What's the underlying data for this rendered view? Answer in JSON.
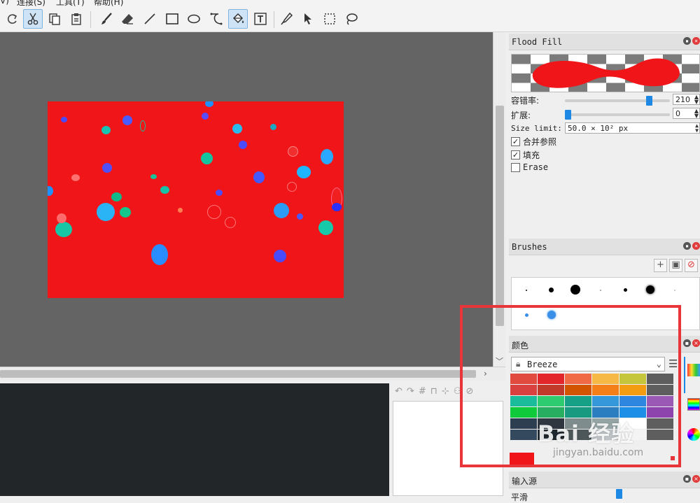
{
  "menu": {
    "item1": "V)",
    "item2": "连接(S)",
    "item3": "工具(T)",
    "item4": "帮助(H)"
  },
  "toolbar": {
    "tools": [
      "redo-icon",
      "cut-icon",
      "copy-icon",
      "paste-icon",
      "brush-icon",
      "eraser-icon",
      "line-icon",
      "rectangle-icon",
      "ellipse-icon",
      "curve-icon",
      "flood-fill-icon",
      "text-icon",
      "color-picker-icon",
      "select-arrow-icon",
      "rect-select-icon",
      "lasso-icon"
    ],
    "active_tools": [
      "cut-icon",
      "flood-fill-icon"
    ]
  },
  "flood_fill": {
    "title": "Flood Fill",
    "tolerance_label": "容错率:",
    "tolerance_value": "210",
    "tolerance_level": 0.82,
    "expand_label": "扩展:",
    "expand_value": "0",
    "expand_level": 0.0,
    "size_limit_label": "Size limit:",
    "size_limit_value": "50.0 × 10² px",
    "merge_label": "合并参照",
    "merge_checked": true,
    "fill_label": "填充",
    "fill_checked": true,
    "erase_label": "Erase",
    "erase_checked": false
  },
  "brushes": {
    "title": "Brushes"
  },
  "colors": {
    "title": "颜色",
    "palette_name": "Breeze",
    "palette": [
      [
        "#e04a3f",
        "#e3262b",
        "#f06a46",
        "#f6b946",
        "#c6c63c",
        "#5e5e5e"
      ],
      [
        "#d94141",
        "#c0392b",
        "#d35400",
        "#f47f18",
        "#f39c12",
        "#5e5e5e"
      ],
      [
        "#1abc9c",
        "#2ecc71",
        "#16a085",
        "#3498db",
        "#2e86de",
        "#9b59b6"
      ],
      [
        "#0fcb3b",
        "#27ae60",
        "#179a7f",
        "#2b7fc0",
        "#1d8fe6",
        "#8e44ad"
      ],
      [
        "#2c3e50",
        "#2f3640",
        "#7f8c8d",
        "#95a5a6",
        "#ffffff",
        "#5e5e5e"
      ],
      [
        "#34495e",
        "#1e272e",
        "#4d5658",
        "#bdc3c7",
        "#f4f4f4",
        "#5e5e5e"
      ]
    ],
    "current_color": "#ef1519"
  },
  "input_source": {
    "title": "输入源",
    "smoothing_label": "平滑"
  },
  "watermark": {
    "main": "Bai 经验",
    "sub": "jingyan.baidu.com"
  }
}
